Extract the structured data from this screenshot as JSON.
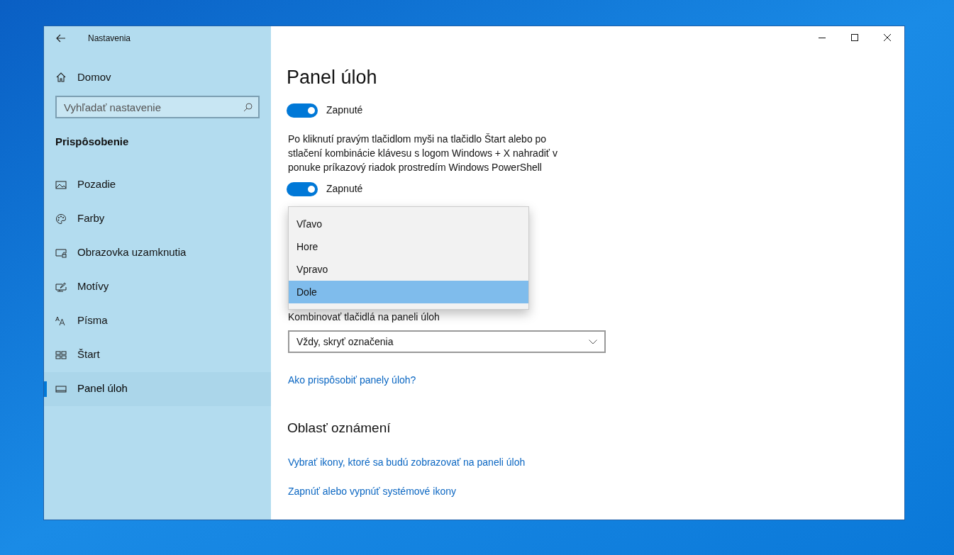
{
  "window": {
    "title": "Nastavenia"
  },
  "sidebar": {
    "home": "Domov",
    "search": {
      "placeholder": "Vyhľadať nastavenie"
    },
    "section": "Prispôsobenie",
    "items": [
      {
        "label": "Pozadie",
        "kind": "picture",
        "selected": false
      },
      {
        "label": "Farby",
        "kind": "palette",
        "selected": false
      },
      {
        "label": "Obrazovka uzamknutia",
        "kind": "lock",
        "selected": false
      },
      {
        "label": "Motívy",
        "kind": "brush",
        "selected": false
      },
      {
        "label": "Písma",
        "kind": "font",
        "selected": false
      },
      {
        "label": "Štart",
        "kind": "start",
        "selected": false
      },
      {
        "label": "Panel úloh",
        "kind": "taskbar",
        "selected": true
      }
    ]
  },
  "page": {
    "title": "Panel úloh",
    "toggle_1": {
      "on": true,
      "label": "Zapnuté"
    },
    "powershell_description": "Po kliknutí pravým tlačidlom myši na tlačidlo Štart alebo po stlačení kombinácie klávesu s logom Windows + X nahradiť v ponuke príkazový riadok prostredím Windows PowerShell",
    "toggle_2": {
      "on": true,
      "label": "Zapnuté"
    },
    "position_dropdown": {
      "options": [
        {
          "label": "Vľavo",
          "selected": false
        },
        {
          "label": "Hore",
          "selected": false
        },
        {
          "label": "Vpravo",
          "selected": false
        },
        {
          "label": "Dole",
          "selected": true
        }
      ]
    },
    "combine_label": "Kombinovať tlačidlá na paneli úloh",
    "combine_value": "Vždy, skryť označenia",
    "help_link": "Ako prispôsobiť panely úloh?",
    "notification_heading": "Oblasť oznámení",
    "notification_links": [
      "Vybrať ikony, ktoré sa budú zobrazovať na paneli úloh",
      "Zapnúť alebo vypnúť systémové ikony"
    ]
  }
}
